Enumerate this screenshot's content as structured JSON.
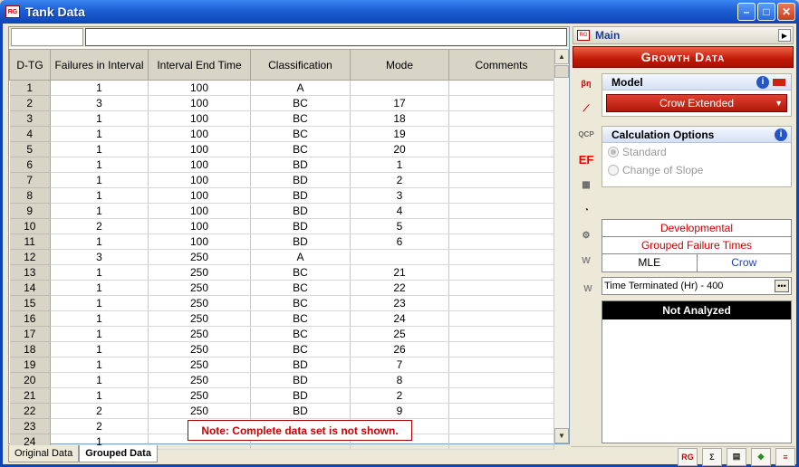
{
  "window": {
    "title": "Tank Data",
    "app_icon_text": "RG"
  },
  "sheet": {
    "headers": [
      "D-TG",
      "Failures in Interval",
      "Interval End Time",
      "Classification",
      "Mode",
      "Comments"
    ],
    "rows": [
      [
        "1",
        "1",
        "100",
        "A",
        "",
        ""
      ],
      [
        "2",
        "3",
        "100",
        "BC",
        "17",
        ""
      ],
      [
        "3",
        "1",
        "100",
        "BC",
        "18",
        ""
      ],
      [
        "4",
        "1",
        "100",
        "BC",
        "19",
        ""
      ],
      [
        "5",
        "1",
        "100",
        "BC",
        "20",
        ""
      ],
      [
        "6",
        "1",
        "100",
        "BD",
        "1",
        ""
      ],
      [
        "7",
        "1",
        "100",
        "BD",
        "2",
        ""
      ],
      [
        "8",
        "1",
        "100",
        "BD",
        "3",
        ""
      ],
      [
        "9",
        "1",
        "100",
        "BD",
        "4",
        ""
      ],
      [
        "10",
        "2",
        "100",
        "BD",
        "5",
        ""
      ],
      [
        "11",
        "1",
        "100",
        "BD",
        "6",
        ""
      ],
      [
        "12",
        "3",
        "250",
        "A",
        "",
        ""
      ],
      [
        "13",
        "1",
        "250",
        "BC",
        "21",
        ""
      ],
      [
        "14",
        "1",
        "250",
        "BC",
        "22",
        ""
      ],
      [
        "15",
        "1",
        "250",
        "BC",
        "23",
        ""
      ],
      [
        "16",
        "1",
        "250",
        "BC",
        "24",
        ""
      ],
      [
        "17",
        "1",
        "250",
        "BC",
        "25",
        ""
      ],
      [
        "18",
        "1",
        "250",
        "BC",
        "26",
        ""
      ],
      [
        "19",
        "1",
        "250",
        "BD",
        "7",
        ""
      ],
      [
        "20",
        "1",
        "250",
        "BD",
        "8",
        ""
      ],
      [
        "21",
        "1",
        "250",
        "BD",
        "2",
        ""
      ],
      [
        "22",
        "2",
        "250",
        "BD",
        "9",
        ""
      ],
      [
        "23",
        "2",
        "",
        "",
        "",
        ""
      ],
      [
        "24",
        "1",
        "",
        "",
        "",
        ""
      ]
    ],
    "note": "Note: Complete data set is not shown.",
    "tabs": [
      "Original Data",
      "Grouped Data"
    ]
  },
  "panel": {
    "header": "Main",
    "banner": "Growth Data",
    "model": {
      "title": "Model",
      "value": "Crow Extended"
    },
    "calc": {
      "title": "Calculation Options",
      "opt1": "Standard",
      "opt2": "Change of Slope"
    },
    "info": {
      "row1": "Developmental",
      "row2": "Grouped Failure Times",
      "method": "MLE",
      "model": "Crow"
    },
    "time_field": "Time Terminated (Hr) - 400",
    "result": "Not Analyzed"
  },
  "icons": {
    "tools": [
      "beta-sigma-mu-icon",
      "plot-icon",
      "qcp-icon",
      "ef-icon",
      "calc-icon",
      "gauge-icon",
      "report-icon",
      "weibull-icon"
    ]
  }
}
